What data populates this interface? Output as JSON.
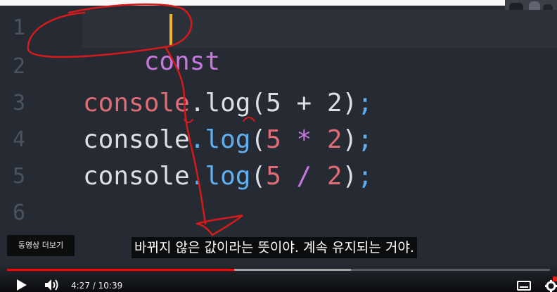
{
  "editor": {
    "line_numbers": [
      "1",
      "2",
      "3",
      "4",
      "5",
      "6"
    ],
    "line1": {
      "keyword": "const"
    },
    "line3": {
      "object": "console",
      "dot": ".",
      "fn": "log",
      "open": "(",
      "a": "5",
      "op": " + ",
      "b": "2",
      "close": ")",
      "semi": ";"
    },
    "line4": {
      "object": "console",
      "dot": ".",
      "fn": "log",
      "open": "(",
      "a": "5",
      "op": " * ",
      "b": "2",
      "close": ")",
      "semi": ";"
    },
    "line5": {
      "object": "console",
      "dot": ".",
      "fn": "log",
      "open": "(",
      "a": "5",
      "op": " / ",
      "b": "2",
      "close": ")",
      "semi": ";"
    }
  },
  "overlay": {
    "more_videos_label": "동영상 더보기",
    "subtitle": "바뀌지 않은 값이라는 뜻이야. 계속 유지되는 거야."
  },
  "player": {
    "current_time": "4:27",
    "separator": " / ",
    "duration": "10:39",
    "progress_fraction": 0.4179,
    "buffered_fraction": 0.634,
    "accent_color": "#ff0000"
  },
  "colors": {
    "editor_bg": "#262b33",
    "keyword": "#c678dd",
    "number": "#e06c75",
    "function": "#61afef",
    "cursor": "#f0b428",
    "annotation": "#d41a1a"
  }
}
